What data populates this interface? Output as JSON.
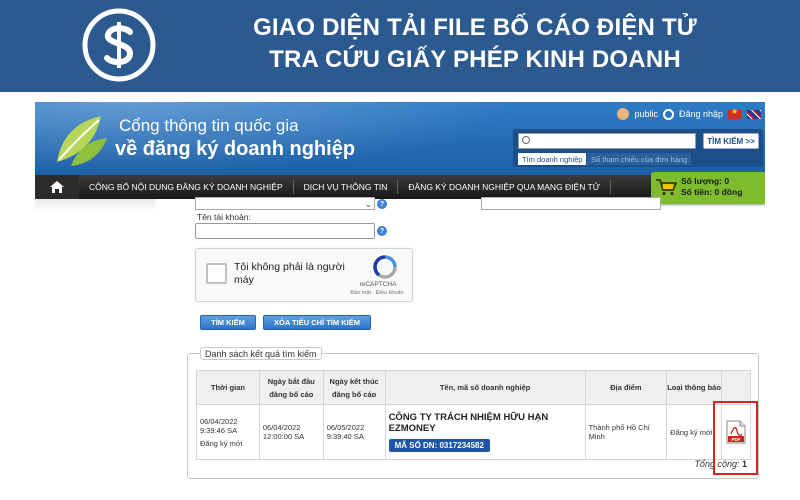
{
  "banner": {
    "title_line1": "GIAO DIỆN TẢI FILE BỐ CÁO ĐIỆN TỬ",
    "title_line2": "TRA CỨU GIẤY PHÉP KINH DOANH",
    "logo_icon": "dollar-logo-icon",
    "color": "#2c5a8f"
  },
  "portal": {
    "title_line1": "Cổng thông tin quốc gia",
    "title_line2": "về đăng ký doanh nghiệp",
    "user_bar": {
      "public_label": "public",
      "login_label": "Đăng nhập"
    },
    "search": {
      "placeholder": "",
      "button_label": "TÌM KIẾM >>",
      "tab_active": "Tìm doanh nghiệp",
      "tab_inactive": "Số tham chiếu của đơn hàng"
    },
    "nav": {
      "items": [
        "CÔNG BỐ NỘI DUNG ĐĂNG KÝ DOANH NGHIỆP",
        "DỊCH VỤ THÔNG TIN",
        "ĐĂNG KÝ DOANH NGHIỆP QUA MẠNG ĐIỆN TỬ"
      ]
    },
    "cart": {
      "quantity_label": "Số lượng: 0",
      "amount_label": "Số tiền: 0 đồng",
      "color": "#7dbd2d"
    }
  },
  "form": {
    "account_label": "Tên tài khoản:",
    "captcha": {
      "text": "Tôi không phải là người máy",
      "brand": "reCAPTCHA",
      "links": "Bảo mật - Điều khoản"
    },
    "search_button": "TÌM KIẾM",
    "clear_button": "XÓA TIÊU CHÍ TÌM KIẾM"
  },
  "results": {
    "legend": "Danh sách kết quả tìm kiếm",
    "headers": {
      "time": "Thời gian",
      "start_date": "Ngày bắt đầu đăng bố cáo",
      "end_date": "Ngày kết thúc đăng bố cáo",
      "company": "Tên, mã số doanh nghiệp",
      "location": "Địa điểm",
      "notice_type": "Loại thông báo"
    },
    "rows": [
      {
        "time_date": "06/04/2022",
        "time_clock": "9:39:46 SA",
        "time_status": "Đăng ký mới",
        "start_date": "06/04/2022",
        "start_time": "12:00:00 SA",
        "end_date": "06/05/2022",
        "end_time": "9:39:40 SA",
        "company_name": "CÔNG TY TRÁCH NHIỆM HỮU HẠN EZMONEY",
        "tax_code": "MÃ SỐ DN: 0317234582",
        "location": "Thành phố Hồ Chí Minh",
        "notice_type": "Đăng ký mới",
        "file_icon": "pdf-file-icon"
      }
    ],
    "total_label": "Tổng cộng:",
    "total_value": "1"
  }
}
